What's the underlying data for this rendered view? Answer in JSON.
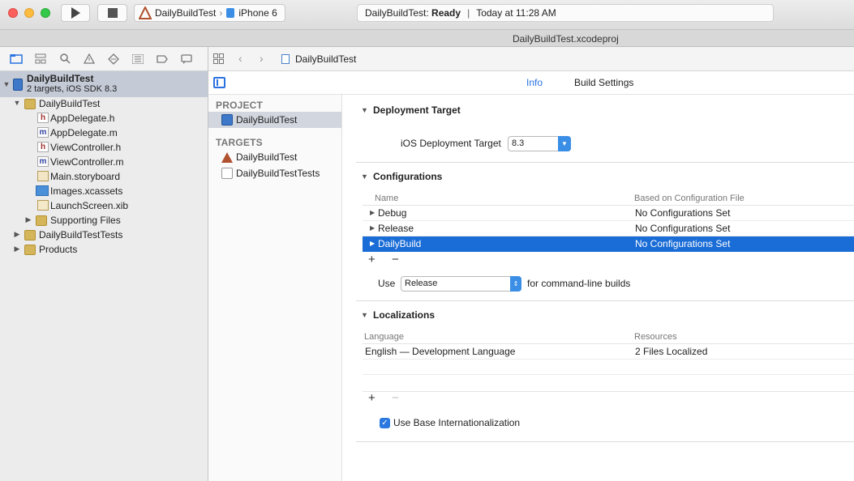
{
  "toolbar": {
    "scheme": {
      "target": "DailyBuildTest",
      "device": "iPhone 6"
    },
    "status": {
      "project": "DailyBuildTest:",
      "state": "Ready",
      "separator": "|",
      "time": "Today at 11:28 AM"
    }
  },
  "window_title": "DailyBuildTest.xcodeproj",
  "navigator": {
    "root": {
      "name": "DailyBuildTest",
      "sub": "2 targets, iOS SDK 8.3"
    },
    "items": [
      {
        "label": "DailyBuildTest",
        "icon": "folder-icon"
      },
      {
        "label": "AppDelegate.h",
        "icon": "header-file-icon",
        "glyph": "h"
      },
      {
        "label": "AppDelegate.m",
        "icon": "objc-file-icon",
        "glyph": "m"
      },
      {
        "label": "ViewController.h",
        "icon": "header-file-icon",
        "glyph": "h"
      },
      {
        "label": "ViewController.m",
        "icon": "objc-file-icon",
        "glyph": "m"
      },
      {
        "label": "Main.storyboard",
        "icon": "storyboard-icon"
      },
      {
        "label": "Images.xcassets",
        "icon": "asset-catalog-icon"
      },
      {
        "label": "LaunchScreen.xib",
        "icon": "xib-icon"
      },
      {
        "label": "Supporting Files",
        "icon": "folder-icon"
      },
      {
        "label": "DailyBuildTestTests",
        "icon": "folder-icon"
      },
      {
        "label": "Products",
        "icon": "folder-icon"
      }
    ]
  },
  "jumpbar": {
    "crumb": "DailyBuildTest"
  },
  "tabs": {
    "info": "Info",
    "build_settings": "Build Settings"
  },
  "project_list": {
    "project_header": "PROJECT",
    "project_item": "DailyBuildTest",
    "targets_header": "TARGETS",
    "targets": [
      "DailyBuildTest",
      "DailyBuildTestTests"
    ]
  },
  "deployment": {
    "title": "Deployment Target",
    "label": "iOS Deployment Target",
    "value": "8.3"
  },
  "configurations": {
    "title": "Configurations",
    "col_name": "Name",
    "col_based": "Based on Configuration File",
    "rows": [
      {
        "name": "Debug",
        "based": "No Configurations Set"
      },
      {
        "name": "Release",
        "based": "No Configurations Set"
      },
      {
        "name": "DailyBuild",
        "based": "No Configurations Set"
      }
    ],
    "use_label": "Use",
    "use_value": "Release",
    "use_suffix": "for command-line builds"
  },
  "localizations": {
    "title": "Localizations",
    "col_language": "Language",
    "col_resources": "Resources",
    "rows": [
      {
        "language": "English — Development Language",
        "resources": "2 Files Localized"
      }
    ],
    "base_i18n_label": "Use Base Internationalization",
    "base_i18n_checked": true
  },
  "colors": {
    "accent": "#2a72e0",
    "selection": "#1a6cd6"
  }
}
